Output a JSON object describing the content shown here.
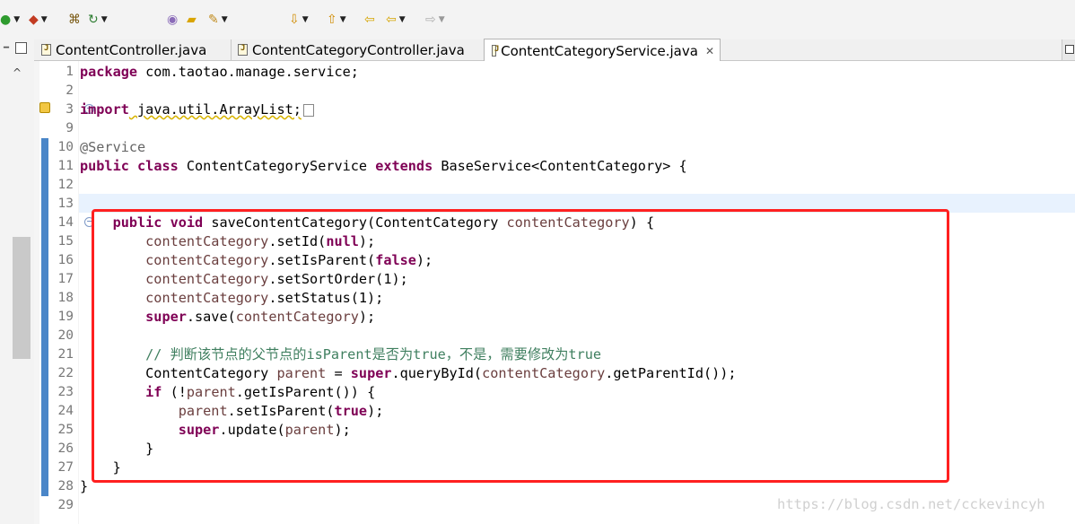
{
  "toolbar": {
    "buttons": [
      {
        "icon": "run-icon",
        "glyph": "●",
        "color": "#2e9b2e"
      },
      {
        "icon": "run-config-icon",
        "glyph": "◆",
        "color": "#c23b22"
      },
      {
        "icon": "build-icon",
        "glyph": "⌘",
        "color": "#7a5a14"
      },
      {
        "icon": "refresh-icon",
        "glyph": "↻",
        "color": "#2e7d32"
      },
      {
        "icon": "open-type-icon",
        "glyph": "◉",
        "color": "#8a6bb8"
      },
      {
        "icon": "open-folder-icon",
        "glyph": "▰",
        "color": "#d9a400"
      },
      {
        "icon": "search-icon",
        "glyph": "✎",
        "color": "#c08a1b"
      },
      {
        "icon": "next-annotation-icon",
        "glyph": "⇩",
        "color": "#d08b00"
      },
      {
        "icon": "prev-annotation-icon",
        "glyph": "⇧",
        "color": "#d08b00"
      },
      {
        "icon": "last-edit-icon",
        "glyph": "⇦",
        "color": "#d6a400"
      },
      {
        "icon": "back-icon",
        "glyph": "⇦",
        "color": "#d6a400"
      },
      {
        "icon": "forward-icon",
        "glyph": "⇨",
        "color": "#b0b0b0"
      }
    ]
  },
  "tabs": [
    {
      "label": "ContentController.java",
      "active": false
    },
    {
      "label": "ContentCategoryController.java",
      "active": false
    },
    {
      "label": "ContentCategoryService.java",
      "active": true
    }
  ],
  "editor": {
    "line_numbers": [
      "1",
      "2",
      "3",
      "9",
      "10",
      "11",
      "12",
      "13",
      "14",
      "15",
      "16",
      "17",
      "18",
      "19",
      "20",
      "21",
      "22",
      "23",
      "24",
      "25",
      "26",
      "27",
      "28",
      "29"
    ],
    "code": {
      "l1_kw": "package",
      "l1_rest": " com.taotao.manage.service;",
      "l3_kw": "import",
      "l3_rest": " java.util.ArrayList;",
      "l10_ann": "@Service",
      "l11_kw1": "public",
      "l11_kw2": "class",
      "l11_mid": " ContentCategoryService ",
      "l11_kw3": "extends",
      "l11_rest": " BaseService<ContentCategory> {",
      "l14_kw1": "public",
      "l14_kw2": "void",
      "l14_mid": " saveContentCategory(ContentCategory ",
      "l14_var": "contentCategory",
      "l14_rest": ") {",
      "var": "contentCategory",
      "l15_rest1": ".setId(",
      "l15_kw": "null",
      "l15_rest2": ");",
      "l16_rest1": ".setIsParent(",
      "l16_kw": "false",
      "l16_rest2": ");",
      "l17_rest": ".setSortOrder(1);",
      "l18_rest": ".setStatus(1);",
      "l19_kw": "super",
      "l19_rest1": ".save(",
      "l19_rest2": ");",
      "l21_comment": "// 判断该节点的父节点的isParent是否为true，不是，需要修改为true",
      "l22_type": "ContentCategory ",
      "l22_var": "parent",
      "l22_eq": " = ",
      "l22_kw": "super",
      "l22_mid": ".queryById(",
      "l22_rest": ".getParentId());",
      "l23_kw": "if",
      "l23_open": " (!",
      "l23_var": "parent",
      "l23_rest": ".getIsParent()) {",
      "l24_var": "parent",
      "l24_mid": ".setIsParent(",
      "l24_kw": "true",
      "l24_rest": ");",
      "l25_kw": "super",
      "l25_mid": ".update(",
      "l25_var": "parent",
      "l25_rest": ");",
      "l26": "}",
      "l27": "}",
      "l28": "}"
    }
  },
  "watermark": "https://blog.csdn.net/cckevincyh",
  "colors": {
    "keyword": "#7f0055",
    "annotation": "#646464",
    "variable": "#6a3e3e",
    "comment": "#3f7f5f",
    "highlight_box": "#ff2020",
    "current_line": "#e8f2fe",
    "change_ruler": "#4a86c8"
  }
}
